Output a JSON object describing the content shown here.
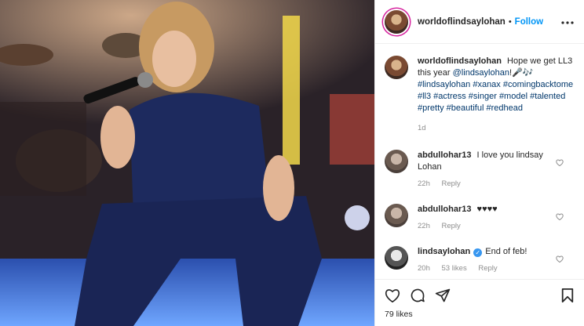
{
  "header": {
    "username": "worldoflindsaylohan",
    "separator": "•",
    "follow_label": "Follow",
    "more_label": "•••"
  },
  "caption": {
    "username": "worldoflindsaylohan",
    "text": "Hope we get LL3 this year",
    "mention": "@lindsaylohan",
    "emoji": "!🎤🎶",
    "hashtags": "#lindsaylohan #xanax #comingbacktome #ll3 #actress #singer #model #talented #pretty #beautiful #redhead",
    "time": "1d"
  },
  "comments": [
    {
      "username": "abdullohar13",
      "text": "I love you lindsay Lohan",
      "time": "22h",
      "reply": "Reply"
    },
    {
      "username": "abdullohar13",
      "text": "♥♥♥♥",
      "time": "22h",
      "reply": "Reply"
    },
    {
      "username": "lindsaylohan",
      "text": "End of feb!",
      "time": "20h",
      "likes": "53 likes",
      "reply": "Reply"
    }
  ],
  "likes_label": "79 likes",
  "icons": [
    "like-icon",
    "comment-icon",
    "share-icon",
    "save-icon",
    "heart-small-icon",
    "verified-icon"
  ],
  "colors": {
    "link": "#0095f6",
    "hashtag": "#00376b",
    "muted": "#8e8e8e",
    "verified": "#3897f0"
  }
}
